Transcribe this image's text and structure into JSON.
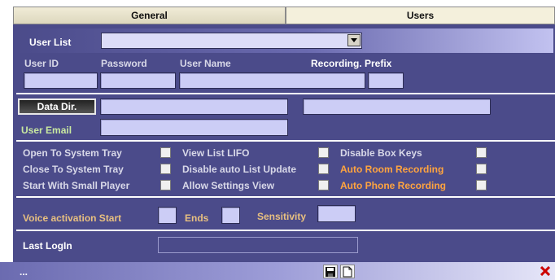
{
  "tabs": [
    {
      "label": "General",
      "active": false
    },
    {
      "label": "Users",
      "active": true
    }
  ],
  "user_list": {
    "label": "User List",
    "selected": ""
  },
  "columns": {
    "user_id": "User ID",
    "password": "Password",
    "user_name": "User Name",
    "recording_prefix": "Recording. Prefix"
  },
  "fields": {
    "user_id": "",
    "password": "",
    "user_name": "",
    "recording_prefix": "",
    "data_dir_1": "",
    "data_dir_2": "",
    "user_email": "",
    "voice_start": "",
    "voice_ends": "",
    "sensitivity": "",
    "last_login": ""
  },
  "data_dir": {
    "button": "Data Dir."
  },
  "user_email": {
    "label": "User Email"
  },
  "options": {
    "col1": [
      "Open To System Tray",
      "Close To System Tray",
      "Start With Small Player"
    ],
    "col2": [
      "View List LIFO",
      "Disable auto List Update",
      "Allow Settings View"
    ],
    "col3": [
      "Disable Box Keys",
      "Auto  Room  Recording",
      "Auto Phone Recording"
    ],
    "col3_colors": [
      "#d8d8e8",
      "#ffa43f",
      "#ffa43f"
    ]
  },
  "voice": {
    "start_label": "Voice activation Start",
    "ends_label": "Ends",
    "sensitivity_label": "Sensitivity"
  },
  "last_login": {
    "label": "Last LogIn"
  },
  "status": {
    "text": "..."
  },
  "icons": {
    "save": "save-icon",
    "new": "new-document-icon",
    "close": "close-icon"
  },
  "colors": {
    "panel": "#4b4b8a",
    "field": "#cccdf6",
    "accent": "#ffa43f",
    "close": "#cc0000"
  }
}
